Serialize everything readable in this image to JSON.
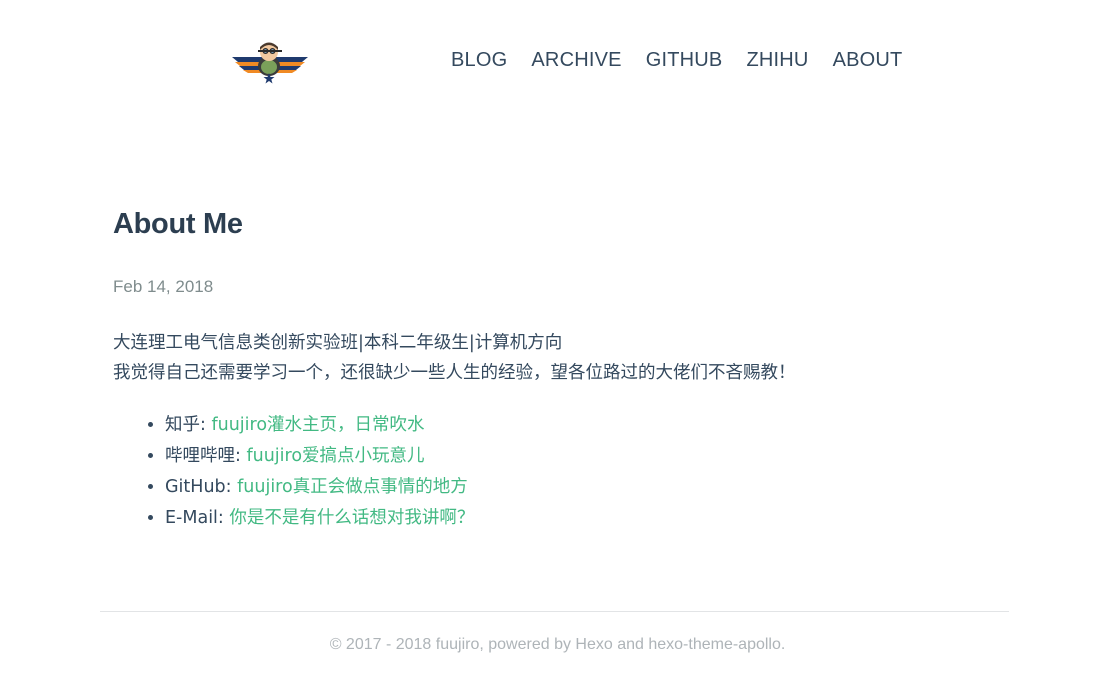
{
  "header": {
    "logo_icon": "pilot-mascot-wings-logo",
    "nav": [
      {
        "label": "BLOG"
      },
      {
        "label": "ARCHIVE"
      },
      {
        "label": "GITHUB"
      },
      {
        "label": "ZHIHU"
      },
      {
        "label": "ABOUT"
      }
    ]
  },
  "post": {
    "title": "About Me",
    "date": "Feb 14, 2018",
    "intro_line1": "大连理工电气信息类创新实验班|本科二年级生|计算机方向",
    "intro_line2": "我觉得自己还需要学习一个，还很缺少一些人生的经验，望各位路过的大佬们不吝赐教！",
    "links": [
      {
        "label": "知乎: ",
        "link_text": "fuujiro灌水主页，日常吹水"
      },
      {
        "label": "哔哩哔哩: ",
        "link_text": "fuujiro爱搞点小玩意儿"
      },
      {
        "label": "GitHub: ",
        "link_text": "fuujiro真正会做点事情的地方"
      },
      {
        "label": "E-Mail: ",
        "link_text": "你是不是有什么话想对我讲啊？"
      }
    ]
  },
  "footer": {
    "text": "© 2017 - 2018 fuujiro, powered by Hexo and hexo-theme-apollo."
  },
  "colors": {
    "text": "#34495e",
    "title": "#2c3e50",
    "link": "#42b983",
    "muted": "#7f8c8d",
    "footer": "#aeb4b8"
  }
}
